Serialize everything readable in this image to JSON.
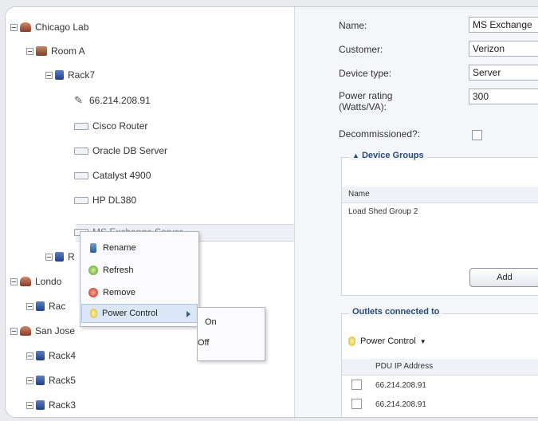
{
  "tree": {
    "nodes": [
      {
        "label": "Chicago Lab"
      },
      {
        "label": "Room A"
      },
      {
        "label": "Rack7"
      },
      {
        "label": "66.214.208.91"
      },
      {
        "label": "Cisco Router"
      },
      {
        "label": "Oracle DB Server"
      },
      {
        "label": "Catalyst 4900"
      },
      {
        "label": "HP DL380"
      },
      {
        "label": "MS Exchange Server"
      },
      {
        "label": "R"
      },
      {
        "label": "Londo"
      },
      {
        "label": "Rac"
      },
      {
        "label": "San Jose"
      },
      {
        "label": "Rack4"
      },
      {
        "label": "Rack5"
      },
      {
        "label": "Rack3"
      }
    ]
  },
  "context_menu": {
    "items": [
      "Rename",
      "Refresh",
      "Remove",
      "Power Control"
    ],
    "submenu": [
      "On",
      "Off"
    ]
  },
  "details": {
    "name_label": "Name:",
    "name_value": "MS Exchange",
    "customer_label": "Customer:",
    "customer_value": "Verizon",
    "device_type_label": "Device type:",
    "device_type_value": "Server",
    "power_label": "Power rating (Watts/VA):",
    "power_value": "300",
    "decom_label": "Decommissioned?:",
    "device_groups_title": "Device Groups",
    "groups_header": "Name",
    "groups_rows": [
      "Load Shed Group 2"
    ],
    "add_button": "Add",
    "outlets_title": "Outlets connected to",
    "power_control": "Power Control",
    "pdu_header": "PDU IP Address",
    "pdu_rows": [
      "66.214.208.91",
      "66.214.208.91"
    ]
  },
  "colors": {
    "accent": "#2b4a7a",
    "menu_highlight": "#dbe7f6",
    "selection": "#edf1f6"
  }
}
